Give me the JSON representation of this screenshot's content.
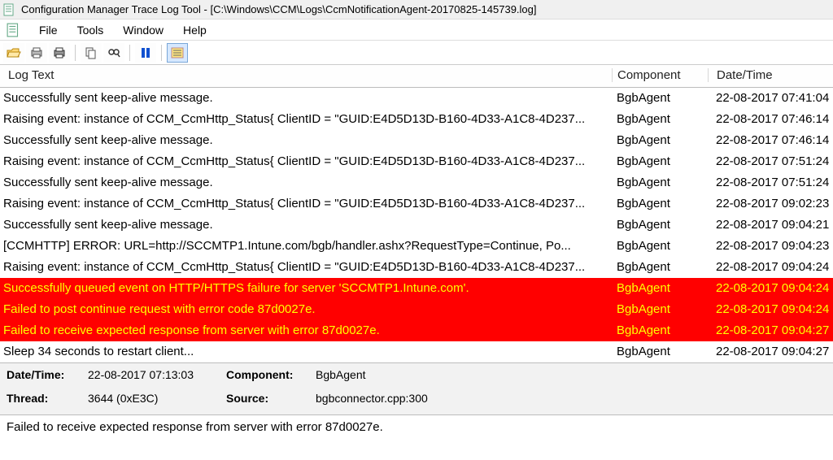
{
  "window": {
    "title": "Configuration Manager Trace Log Tool - [C:\\Windows\\CCM\\Logs\\CcmNotificationAgent-20170825-145739.log]"
  },
  "menu": {
    "file": "File",
    "tools": "Tools",
    "window": "Window",
    "help": "Help"
  },
  "columns": {
    "log": "Log Text",
    "comp": "Component",
    "date": "Date/Time"
  },
  "rows": [
    {
      "text": "Successfully sent keep-alive message.",
      "comp": "BgbAgent",
      "date": "22-08-2017 07:41:04",
      "err": false
    },
    {
      "text": "Raising event: instance of CCM_CcmHttp_Status{ ClientID = \"GUID:E4D5D13D-B160-4D33-A1C8-4D237...",
      "comp": "BgbAgent",
      "date": "22-08-2017 07:46:14",
      "err": false
    },
    {
      "text": "Successfully sent keep-alive message.",
      "comp": "BgbAgent",
      "date": "22-08-2017 07:46:14",
      "err": false
    },
    {
      "text": "Raising event: instance of CCM_CcmHttp_Status{ ClientID = \"GUID:E4D5D13D-B160-4D33-A1C8-4D237...",
      "comp": "BgbAgent",
      "date": "22-08-2017 07:51:24",
      "err": false
    },
    {
      "text": "Successfully sent keep-alive message.",
      "comp": "BgbAgent",
      "date": "22-08-2017 07:51:24",
      "err": false
    },
    {
      "text": "Raising event: instance of CCM_CcmHttp_Status{ ClientID = \"GUID:E4D5D13D-B160-4D33-A1C8-4D237...",
      "comp": "BgbAgent",
      "date": "22-08-2017 09:02:23",
      "err": false
    },
    {
      "text": "Successfully sent keep-alive message.",
      "comp": "BgbAgent",
      "date": "22-08-2017 09:04:21",
      "err": false
    },
    {
      "text": "[CCMHTTP] ERROR: URL=http://SCCMTP1.Intune.com/bgb/handler.ashx?RequestType=Continue, Po...",
      "comp": "BgbAgent",
      "date": "22-08-2017 09:04:23",
      "err": false
    },
    {
      "text": "Raising event: instance of CCM_CcmHttp_Status{ ClientID = \"GUID:E4D5D13D-B160-4D33-A1C8-4D237...",
      "comp": "BgbAgent",
      "date": "22-08-2017 09:04:24",
      "err": false
    },
    {
      "text": "Successfully queued event on HTTP/HTTPS failure for server 'SCCMTP1.Intune.com'.",
      "comp": "BgbAgent",
      "date": "22-08-2017 09:04:24",
      "err": true
    },
    {
      "text": "Failed to post continue request with error code 87d0027e.",
      "comp": "BgbAgent",
      "date": "22-08-2017 09:04:24",
      "err": true
    },
    {
      "text": "Failed to receive expected response from server with error 87d0027e.",
      "comp": "BgbAgent",
      "date": "22-08-2017 09:04:27",
      "err": true
    },
    {
      "text": "Sleep 34 seconds to restart client...",
      "comp": "BgbAgent",
      "date": "22-08-2017 09:04:27",
      "err": false
    }
  ],
  "details": {
    "labels": {
      "datetime": "Date/Time:",
      "component": "Component:",
      "thread": "Thread:",
      "source": "Source:"
    },
    "datetime": "22-08-2017 07:13:03",
    "component": "BgbAgent",
    "thread": "3644 (0xE3C)",
    "source": "bgbconnector.cpp:300"
  },
  "message": "Failed to receive expected response from server with error 87d0027e."
}
